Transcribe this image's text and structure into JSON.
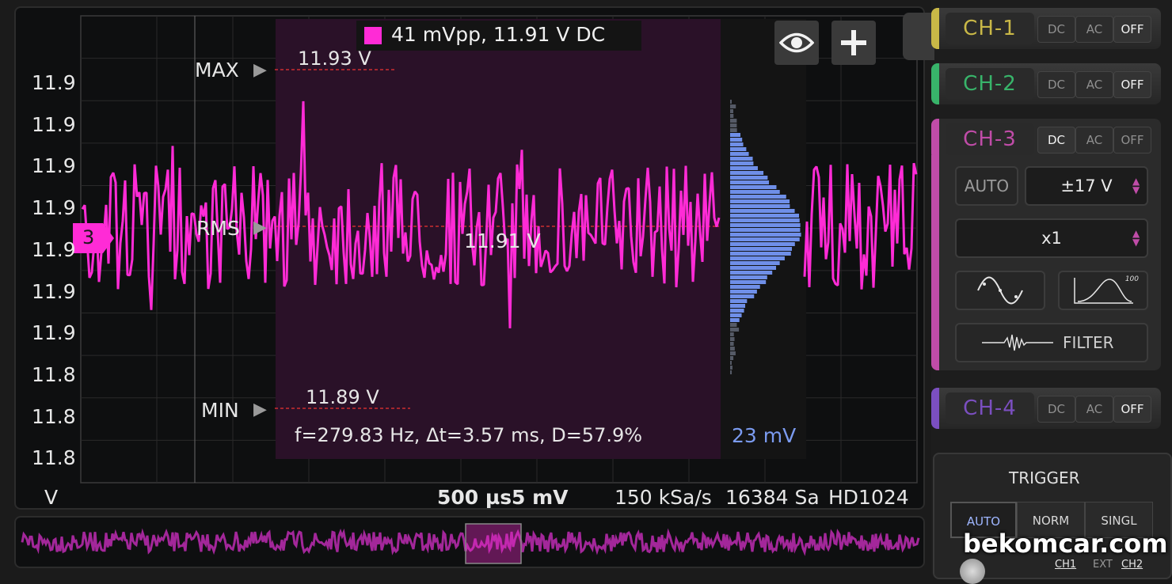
{
  "scope": {
    "measurement_label": "41 mVpp, 11.91 V DC",
    "series_color": "#ff2bd6",
    "max_label": "MAX",
    "max_value": "11.93 V",
    "rms_label": "RMS",
    "rms_value": "11.91 V",
    "min_label": "MIN",
    "min_value": "11.89 V",
    "freq_readout": "f=279.83 Hz, Δt=3.57 ms, D=57.9%",
    "histogram_value": "23 mV",
    "histogram_color": "#6f8fe8",
    "channel_marker": "3",
    "y_tick_labels": [
      "11.9",
      "11.9",
      "11.9",
      "11.9",
      "11.9",
      "11.9",
      "11.9",
      "11.8",
      "11.8",
      "11.8"
    ],
    "y_unit": "V",
    "timebase": "500 µs",
    "volts_div": "5 mV",
    "sample_rate": "150 kSa/s",
    "sample_count": "16384 Sa",
    "resolution": "HD1024"
  },
  "buttons": {
    "eye_icon": "eye-icon",
    "add_icon": "plus-icon"
  },
  "channels": [
    {
      "name": "CH-1",
      "color": "#c9b847",
      "dc": "DC",
      "ac": "AC",
      "off": "OFF",
      "active": "OFF"
    },
    {
      "name": "CH-2",
      "color": "#38b46a",
      "dc": "DC",
      "ac": "AC",
      "off": "OFF",
      "active": "OFF"
    },
    {
      "name": "CH-3",
      "color": "#c04ca8",
      "dc": "DC",
      "ac": "AC",
      "off": "OFF",
      "active": "DC"
    },
    {
      "name": "CH-4",
      "color": "#7b4fc0",
      "dc": "DC",
      "ac": "AC",
      "off": "OFF",
      "active": "OFF"
    }
  ],
  "ch3": {
    "auto_label": "AUTO",
    "range_value": "±17 V",
    "probe_value": "x1",
    "filter_label": "FILTER",
    "hist_icon_label": "100"
  },
  "trigger": {
    "title": "TRIGGER",
    "auto": "AUTO",
    "norm": "NORM",
    "single": "SINGL",
    "selected": "AUTO",
    "source_ch1": "CH1",
    "source_ext": "EXT",
    "source_ch2": "CH2"
  },
  "watermark": "bekomcar.com"
}
